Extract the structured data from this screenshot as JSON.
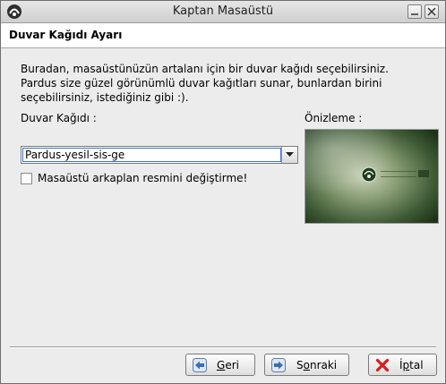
{
  "window": {
    "title": "Kaptan Masaüstü"
  },
  "header": {
    "title": "Duvar Kağıdı Ayarı"
  },
  "description": {
    "line1": "Buradan, masaüstünüzün artalanı için bir duvar kağıdı seçebilirsiniz.",
    "line2": "Pardus size güzel görünümlü duvar kağıtları sunar, bunlardan birini",
    "line3": "seçebilirsiniz, istediğiniz gibi :)."
  },
  "wallpaper": {
    "label": "Duvar Kağıdı :",
    "selected": "Pardus-yesil-sis-ge"
  },
  "checkbox": {
    "label": "Masaüstü arkaplan resmini değiştirme!",
    "checked": false
  },
  "preview": {
    "label": "Önizleme :"
  },
  "buttons": {
    "back": {
      "mnemonic": "G",
      "rest": "eri"
    },
    "next": {
      "pre": "S",
      "mnemonic": "o",
      "rest": "nraki"
    },
    "cancel": {
      "pre": "İ",
      "mnemonic": "p",
      "rest": "tal"
    }
  },
  "icons": {
    "app": "pardus-logo-icon",
    "minimize": "minimize-icon",
    "close": "close-icon",
    "combo": "chevron-down-icon",
    "back": "arrow-left-icon",
    "next": "arrow-right-icon",
    "cancel": "red-x-icon"
  }
}
